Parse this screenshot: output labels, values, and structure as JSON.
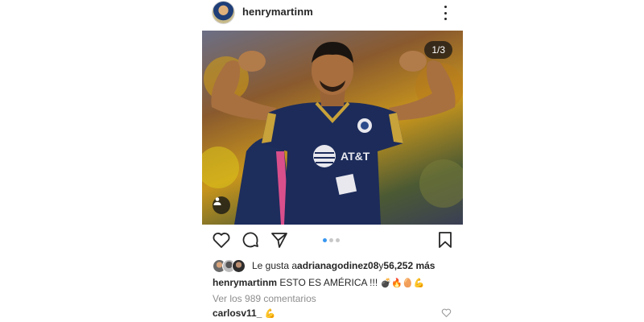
{
  "post": {
    "username": "henrymartinm",
    "image_counter": "1/3",
    "likes": {
      "prefix": "Le gusta a ",
      "user": "adrianagodinez08",
      "connector": " y ",
      "count": "56,252 más"
    },
    "caption": {
      "username": "henrymartinm",
      "text": " ESTO ES AMÉRICA !!! ",
      "emojis": "💣🔥🥚💪"
    },
    "view_comments": "Ver los 989 comentarios",
    "comment": {
      "username": "carlosv11_",
      "emoji": "💪"
    },
    "carousel": {
      "total": 3,
      "active_index": 0
    },
    "jersey_text": "AT&T",
    "colors": {
      "accent_dot": "#3897f0",
      "text": "#262626",
      "muted": "#8e8e8e"
    }
  }
}
